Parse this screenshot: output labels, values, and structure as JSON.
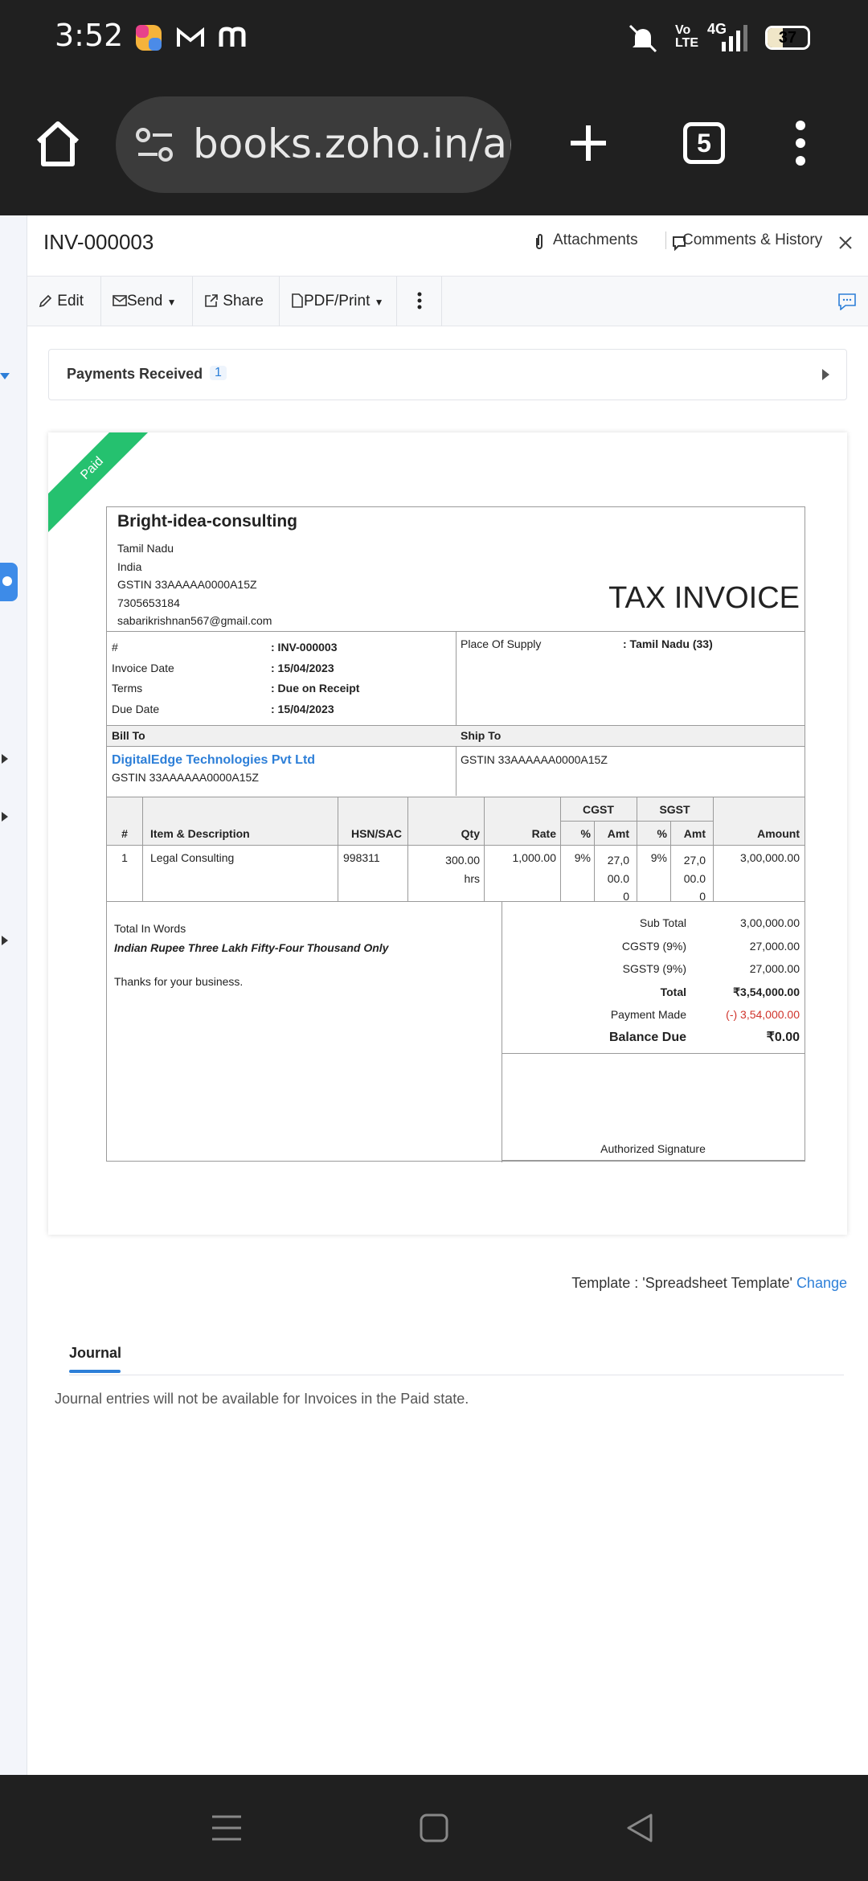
{
  "status_bar": {
    "time": "3:52",
    "battery": "37",
    "network": "4G"
  },
  "browser": {
    "url": "books.zoho.in/ap",
    "tab_count": "5"
  },
  "header": {
    "invoice_id": "INV-000003",
    "attachments": "Attachments",
    "comments": "Comments & History"
  },
  "toolbar": {
    "edit": "Edit",
    "send": "Send",
    "share": "Share",
    "pdf_print": "PDF/Print"
  },
  "payments": {
    "label": "Payments Received",
    "count": "1"
  },
  "invoice": {
    "status": "Paid",
    "company": "Bright-idea-consulting",
    "address": [
      "Tamil Nadu",
      "India",
      "GSTIN 33AAAAA0000A15Z",
      "7305653184",
      "sabarikrishnan567@gmail.com"
    ],
    "doc_title": "TAX INVOICE",
    "meta": [
      {
        "label": "#",
        "value": ": INV-000003"
      },
      {
        "label": "Invoice Date",
        "value": ": 15/04/2023"
      },
      {
        "label": "Terms",
        "value": ": Due on Receipt"
      },
      {
        "label": "Due Date",
        "value": ": 15/04/2023"
      }
    ],
    "place_of_supply_label": "Place Of Supply",
    "place_of_supply_value": ": Tamil Nadu (33)",
    "bill_to_label": "Bill To",
    "ship_to_label": "Ship To",
    "bill_to_name": "DigitalEdge Technologies Pvt Ltd",
    "bill_to_gstin": "GSTIN 33AAAAAA0000A15Z",
    "ship_to_gstin": "GSTIN 33AAAAAA0000A15Z",
    "columns": {
      "num": "#",
      "item": "Item & Description",
      "hsn": "HSN/SAC",
      "qty": "Qty",
      "rate": "Rate",
      "cgst": "CGST",
      "sgst": "SGST",
      "pct": "%",
      "amt": "Amt",
      "amount": "Amount"
    },
    "item": {
      "num": "1",
      "desc": "Legal Consulting",
      "hsn": "998311",
      "qty": "300.00",
      "unit": "hrs",
      "rate": "1,000.00",
      "cgst_pct": "9%",
      "cgst_amt": [
        "27,0",
        "00.0",
        "0"
      ],
      "sgst_pct": "9%",
      "sgst_amt": [
        "27,0",
        "00.0",
        "0"
      ],
      "amount": "3,00,000.00"
    },
    "words_label": "Total In Words",
    "words": "Indian Rupee Three Lakh Fifty-Four Thousand Only",
    "thanks": "Thanks for your business.",
    "totals": [
      {
        "label": "Sub Total",
        "value": "3,00,000.00"
      },
      {
        "label": "CGST9 (9%)",
        "value": "27,000.00"
      },
      {
        "label": "SGST9 (9%)",
        "value": "27,000.00"
      },
      {
        "label": "Total",
        "value": "₹3,54,000.00"
      },
      {
        "label": "Payment Made",
        "value": "(-) 3,54,000.00"
      },
      {
        "label": "Balance Due",
        "value": "₹0.00"
      }
    ],
    "signature": "Authorized Signature"
  },
  "template": {
    "label": "Template : 'Spreadsheet Template'",
    "change": "Change"
  },
  "journal": {
    "tab": "Journal",
    "message": "Journal entries will not be available for Invoices in the Paid state."
  },
  "colors": {
    "accent": "#2d7fd8",
    "paid": "#25c16f",
    "negative": "#d0342c"
  }
}
